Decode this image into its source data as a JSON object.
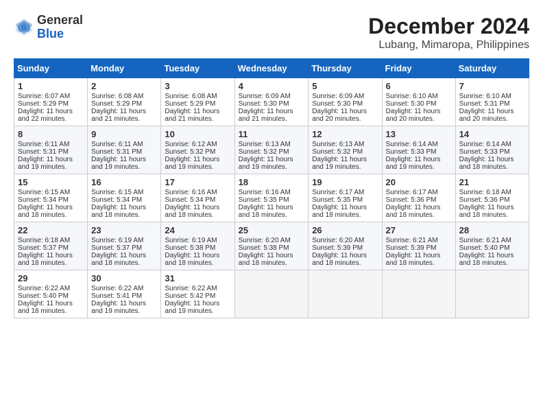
{
  "header": {
    "logo_line1": "General",
    "logo_line2": "Blue",
    "title": "December 2024",
    "subtitle": "Lubang, Mimaropa, Philippines"
  },
  "calendar": {
    "days_of_week": [
      "Sunday",
      "Monday",
      "Tuesday",
      "Wednesday",
      "Thursday",
      "Friday",
      "Saturday"
    ],
    "weeks": [
      [
        {
          "day": "",
          "empty": true
        },
        {
          "day": "",
          "empty": true
        },
        {
          "day": "",
          "empty": true
        },
        {
          "day": "",
          "empty": true
        },
        {
          "day": "",
          "empty": true
        },
        {
          "day": "",
          "empty": true
        },
        {
          "day": "",
          "empty": true
        }
      ],
      [
        {
          "day": "1",
          "sunrise": "Sunrise: 6:07 AM",
          "sunset": "Sunset: 5:29 PM",
          "daylight": "Daylight: 11 hours and 22 minutes."
        },
        {
          "day": "2",
          "sunrise": "Sunrise: 6:08 AM",
          "sunset": "Sunset: 5:29 PM",
          "daylight": "Daylight: 11 hours and 21 minutes."
        },
        {
          "day": "3",
          "sunrise": "Sunrise: 6:08 AM",
          "sunset": "Sunset: 5:29 PM",
          "daylight": "Daylight: 11 hours and 21 minutes."
        },
        {
          "day": "4",
          "sunrise": "Sunrise: 6:09 AM",
          "sunset": "Sunset: 5:30 PM",
          "daylight": "Daylight: 11 hours and 21 minutes."
        },
        {
          "day": "5",
          "sunrise": "Sunrise: 6:09 AM",
          "sunset": "Sunset: 5:30 PM",
          "daylight": "Daylight: 11 hours and 20 minutes."
        },
        {
          "day": "6",
          "sunrise": "Sunrise: 6:10 AM",
          "sunset": "Sunset: 5:30 PM",
          "daylight": "Daylight: 11 hours and 20 minutes."
        },
        {
          "day": "7",
          "sunrise": "Sunrise: 6:10 AM",
          "sunset": "Sunset: 5:31 PM",
          "daylight": "Daylight: 11 hours and 20 minutes."
        }
      ],
      [
        {
          "day": "8",
          "sunrise": "Sunrise: 6:11 AM",
          "sunset": "Sunset: 5:31 PM",
          "daylight": "Daylight: 11 hours and 19 minutes."
        },
        {
          "day": "9",
          "sunrise": "Sunrise: 6:11 AM",
          "sunset": "Sunset: 5:31 PM",
          "daylight": "Daylight: 11 hours and 19 minutes."
        },
        {
          "day": "10",
          "sunrise": "Sunrise: 6:12 AM",
          "sunset": "Sunset: 5:32 PM",
          "daylight": "Daylight: 11 hours and 19 minutes."
        },
        {
          "day": "11",
          "sunrise": "Sunrise: 6:13 AM",
          "sunset": "Sunset: 5:32 PM",
          "daylight": "Daylight: 11 hours and 19 minutes."
        },
        {
          "day": "12",
          "sunrise": "Sunrise: 6:13 AM",
          "sunset": "Sunset: 5:32 PM",
          "daylight": "Daylight: 11 hours and 19 minutes."
        },
        {
          "day": "13",
          "sunrise": "Sunrise: 6:14 AM",
          "sunset": "Sunset: 5:33 PM",
          "daylight": "Daylight: 11 hours and 19 minutes."
        },
        {
          "day": "14",
          "sunrise": "Sunrise: 6:14 AM",
          "sunset": "Sunset: 5:33 PM",
          "daylight": "Daylight: 11 hours and 18 minutes."
        }
      ],
      [
        {
          "day": "15",
          "sunrise": "Sunrise: 6:15 AM",
          "sunset": "Sunset: 5:34 PM",
          "daylight": "Daylight: 11 hours and 18 minutes."
        },
        {
          "day": "16",
          "sunrise": "Sunrise: 6:15 AM",
          "sunset": "Sunset: 5:34 PM",
          "daylight": "Daylight: 11 hours and 18 minutes."
        },
        {
          "day": "17",
          "sunrise": "Sunrise: 6:16 AM",
          "sunset": "Sunset: 5:34 PM",
          "daylight": "Daylight: 11 hours and 18 minutes."
        },
        {
          "day": "18",
          "sunrise": "Sunrise: 6:16 AM",
          "sunset": "Sunset: 5:35 PM",
          "daylight": "Daylight: 11 hours and 18 minutes."
        },
        {
          "day": "19",
          "sunrise": "Sunrise: 6:17 AM",
          "sunset": "Sunset: 5:35 PM",
          "daylight": "Daylight: 11 hours and 18 minutes."
        },
        {
          "day": "20",
          "sunrise": "Sunrise: 6:17 AM",
          "sunset": "Sunset: 5:36 PM",
          "daylight": "Daylight: 11 hours and 18 minutes."
        },
        {
          "day": "21",
          "sunrise": "Sunrise: 6:18 AM",
          "sunset": "Sunset: 5:36 PM",
          "daylight": "Daylight: 11 hours and 18 minutes."
        }
      ],
      [
        {
          "day": "22",
          "sunrise": "Sunrise: 6:18 AM",
          "sunset": "Sunset: 5:37 PM",
          "daylight": "Daylight: 11 hours and 18 minutes."
        },
        {
          "day": "23",
          "sunrise": "Sunrise: 6:19 AM",
          "sunset": "Sunset: 5:37 PM",
          "daylight": "Daylight: 11 hours and 18 minutes."
        },
        {
          "day": "24",
          "sunrise": "Sunrise: 6:19 AM",
          "sunset": "Sunset: 5:38 PM",
          "daylight": "Daylight: 11 hours and 18 minutes."
        },
        {
          "day": "25",
          "sunrise": "Sunrise: 6:20 AM",
          "sunset": "Sunset: 5:38 PM",
          "daylight": "Daylight: 11 hours and 18 minutes."
        },
        {
          "day": "26",
          "sunrise": "Sunrise: 6:20 AM",
          "sunset": "Sunset: 5:39 PM",
          "daylight": "Daylight: 11 hours and 18 minutes."
        },
        {
          "day": "27",
          "sunrise": "Sunrise: 6:21 AM",
          "sunset": "Sunset: 5:39 PM",
          "daylight": "Daylight: 11 hours and 18 minutes."
        },
        {
          "day": "28",
          "sunrise": "Sunrise: 6:21 AM",
          "sunset": "Sunset: 5:40 PM",
          "daylight": "Daylight: 11 hours and 18 minutes."
        }
      ],
      [
        {
          "day": "29",
          "sunrise": "Sunrise: 6:22 AM",
          "sunset": "Sunset: 5:40 PM",
          "daylight": "Daylight: 11 hours and 18 minutes."
        },
        {
          "day": "30",
          "sunrise": "Sunrise: 6:22 AM",
          "sunset": "Sunset: 5:41 PM",
          "daylight": "Daylight: 11 hours and 19 minutes."
        },
        {
          "day": "31",
          "sunrise": "Sunrise: 6:22 AM",
          "sunset": "Sunset: 5:42 PM",
          "daylight": "Daylight: 11 hours and 19 minutes."
        },
        {
          "day": "",
          "empty": true
        },
        {
          "day": "",
          "empty": true
        },
        {
          "day": "",
          "empty": true
        },
        {
          "day": "",
          "empty": true
        }
      ]
    ]
  }
}
